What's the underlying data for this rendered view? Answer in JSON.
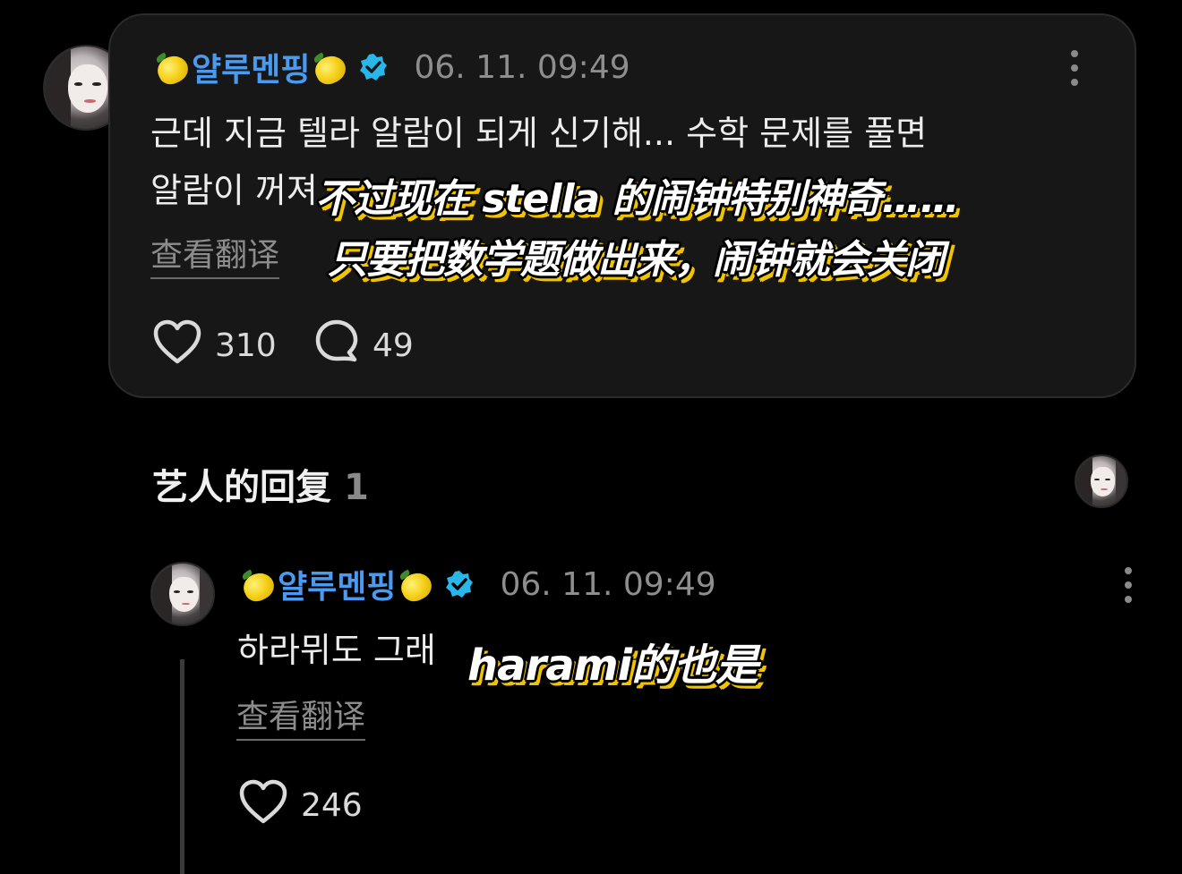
{
  "main_comment": {
    "username": "얄루멘핑",
    "date": "06. 11. 09:49",
    "text_line1": "근데 지금 텔라 알람이 되게 신기해... 수학 문제를 풀면",
    "text_line2": "알람이 꺼져",
    "translate_label": "查看翻译",
    "likes": "310",
    "comments": "49",
    "subtitle_line1": "不过现在 stella 的闹钟特别神奇……",
    "subtitle_line2": "只要把数学题做出来，闹钟就会关闭"
  },
  "replies_section": {
    "title": "艺人的回复",
    "count": "1"
  },
  "reply": {
    "username": "얄루멘핑",
    "date": "06. 11. 09:49",
    "text": "하라뮈도 그래",
    "translate_label": "查看翻译",
    "likes": "246",
    "subtitle": "harami的也是"
  },
  "colors": {
    "username": "#4a9bf0",
    "verified_badge": "#29b6e8",
    "subtitle_outline": "#f2c400"
  },
  "icons": [
    "lemon-icon",
    "verified-badge-icon",
    "more-options-icon",
    "heart-icon",
    "comment-bubble-icon"
  ]
}
